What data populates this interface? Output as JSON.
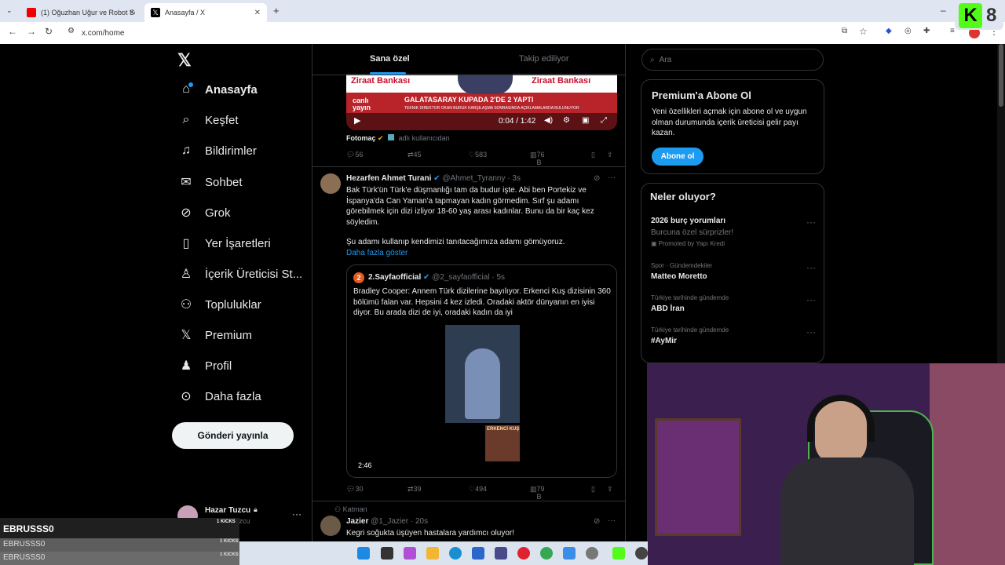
{
  "browser": {
    "tabs": [
      {
        "title": "(1) Oğuzhan Uğur ve Robot Sop",
        "favicon": "youtube-icon"
      },
      {
        "title": "Anasayfa / X",
        "favicon": "x-logo-icon"
      }
    ],
    "url": "x.com/home"
  },
  "sidebar": {
    "items": [
      {
        "label": "Anasayfa",
        "icon": "home-icon"
      },
      {
        "label": "Keşfet",
        "icon": "search-icon"
      },
      {
        "label": "Bildirimler",
        "icon": "bell-icon"
      },
      {
        "label": "Sohbet",
        "icon": "mail-icon"
      },
      {
        "label": "Grok",
        "icon": "grok-icon"
      },
      {
        "label": "Yer İşaretleri",
        "icon": "bookmark-icon"
      },
      {
        "label": "İçerik Üreticisi St...",
        "icon": "creator-icon"
      },
      {
        "label": "Topluluklar",
        "icon": "communities-icon"
      },
      {
        "label": "Premium",
        "icon": "x-logo-icon"
      },
      {
        "label": "Profil",
        "icon": "person-icon"
      },
      {
        "label": "Daha fazla",
        "icon": "more-circle-icon"
      }
    ],
    "post_button": "Gönderi yayınla",
    "account": {
      "name": "Hazar Tuzcu",
      "handle": "@HazarTuzcu"
    }
  },
  "timeline": {
    "tabs": [
      "Sana özel",
      "Takip ediliyor"
    ],
    "post1": {
      "video_banner_brand": "Ziraat Bankası",
      "video_headline": "GALATASARAY KUPADA 2'DE 2 YAPTI",
      "video_subline": "TEKNİK DİREKTÖR OKAN BURUK KARŞILAŞMA SONRASINDA AÇIKLAMALARDA BULUNUYOR",
      "live_tag": "canlı yayın",
      "video_time": "0:04 / 1:42",
      "source": "Fotomaç",
      "source_note": "adlı kullanıcıdan",
      "replies": "56",
      "reposts": "45",
      "likes": "583",
      "views": "76 B"
    },
    "post2": {
      "author": "Hezarfen Ahmet Turani",
      "handle": "@Ahmet_Tyranny",
      "time": "· 3s",
      "text1": "Bak Türk'ün Türk'e düşmanlığı tam da budur işte. Abi ben Portekiz ve İspanya'da Can Yaman'a tapmayan kadın görmedim. Sırf şu adamı görebilmek için dizi izliyor 18-60 yaş arası kadınlar. Bunu da bir kaç kez söyledim.",
      "text2": "Şu adamı kullanıp kendimizi tanıtacağımıza adamı gömüyoruz.",
      "show_more": "Daha fazla göster",
      "quote": {
        "author": "2.Sayfaofficial",
        "handle": "@2_sayfaofficial",
        "time": "· 5s",
        "text": "Bradley Cooper: Annem Türk dizilerine bayılıyor. Erkenci Kuş dizisinin 360 bölümü falan var. Hepsini 4 kez izledi. Oradaki aktör dünyanın en iyisi diyor. Bu arada dizi de iyi, oradaki kadın da iyi",
        "video_duration": "2:46",
        "poster_title": "ERKENCİ KUŞ"
      },
      "replies": "30",
      "reposts": "39",
      "likes": "494",
      "views": "79 B"
    },
    "post3": {
      "context": "Katman",
      "author": "Jazier",
      "handle": "@1_Jazier",
      "time": "· 20s",
      "text": "Kegri soğukta üşüyen hastalara yardımcı oluyor!"
    }
  },
  "right_sidebar": {
    "search_placeholder": "Ara",
    "premium": {
      "title": "Premium'a Abone Ol",
      "body": "Yeni özellikleri açmak için abone ol ve uygun olman durumunda içerik üreticisi gelir payı kazan.",
      "button": "Abone ol"
    },
    "trends_title": "Neler oluyor?",
    "trends": [
      {
        "context": "",
        "title": "2026 burç yorumları",
        "sub": "Burcuna özel sürprizler!",
        "promo": "Promoted by Yapı Kredi"
      },
      {
        "context": "Spor · Gündemdekiler",
        "title": "Matteo Moretto",
        "sub": "",
        "promo": ""
      },
      {
        "context": "Türkiye tarihinde gündemde",
        "title": "ABD İran",
        "sub": "",
        "promo": ""
      },
      {
        "context": "Türkiye tarihinde gündemde",
        "title": "#AyMir",
        "sub": "",
        "promo": ""
      }
    ]
  },
  "overlay": {
    "kick_logo": "K",
    "kick_count": "8",
    "chat": [
      {
        "user": "EBRUSSS0",
        "badge": "1 KICKS"
      },
      {
        "user": "EBRUSSS0",
        "badge": "1 KICKS"
      },
      {
        "user": "EBRUSSS0",
        "badge": "1 KICKS"
      }
    ]
  },
  "colors": {
    "accent": "#1d9bf0",
    "kick_green": "#53fc18",
    "border": "#2f3336"
  }
}
